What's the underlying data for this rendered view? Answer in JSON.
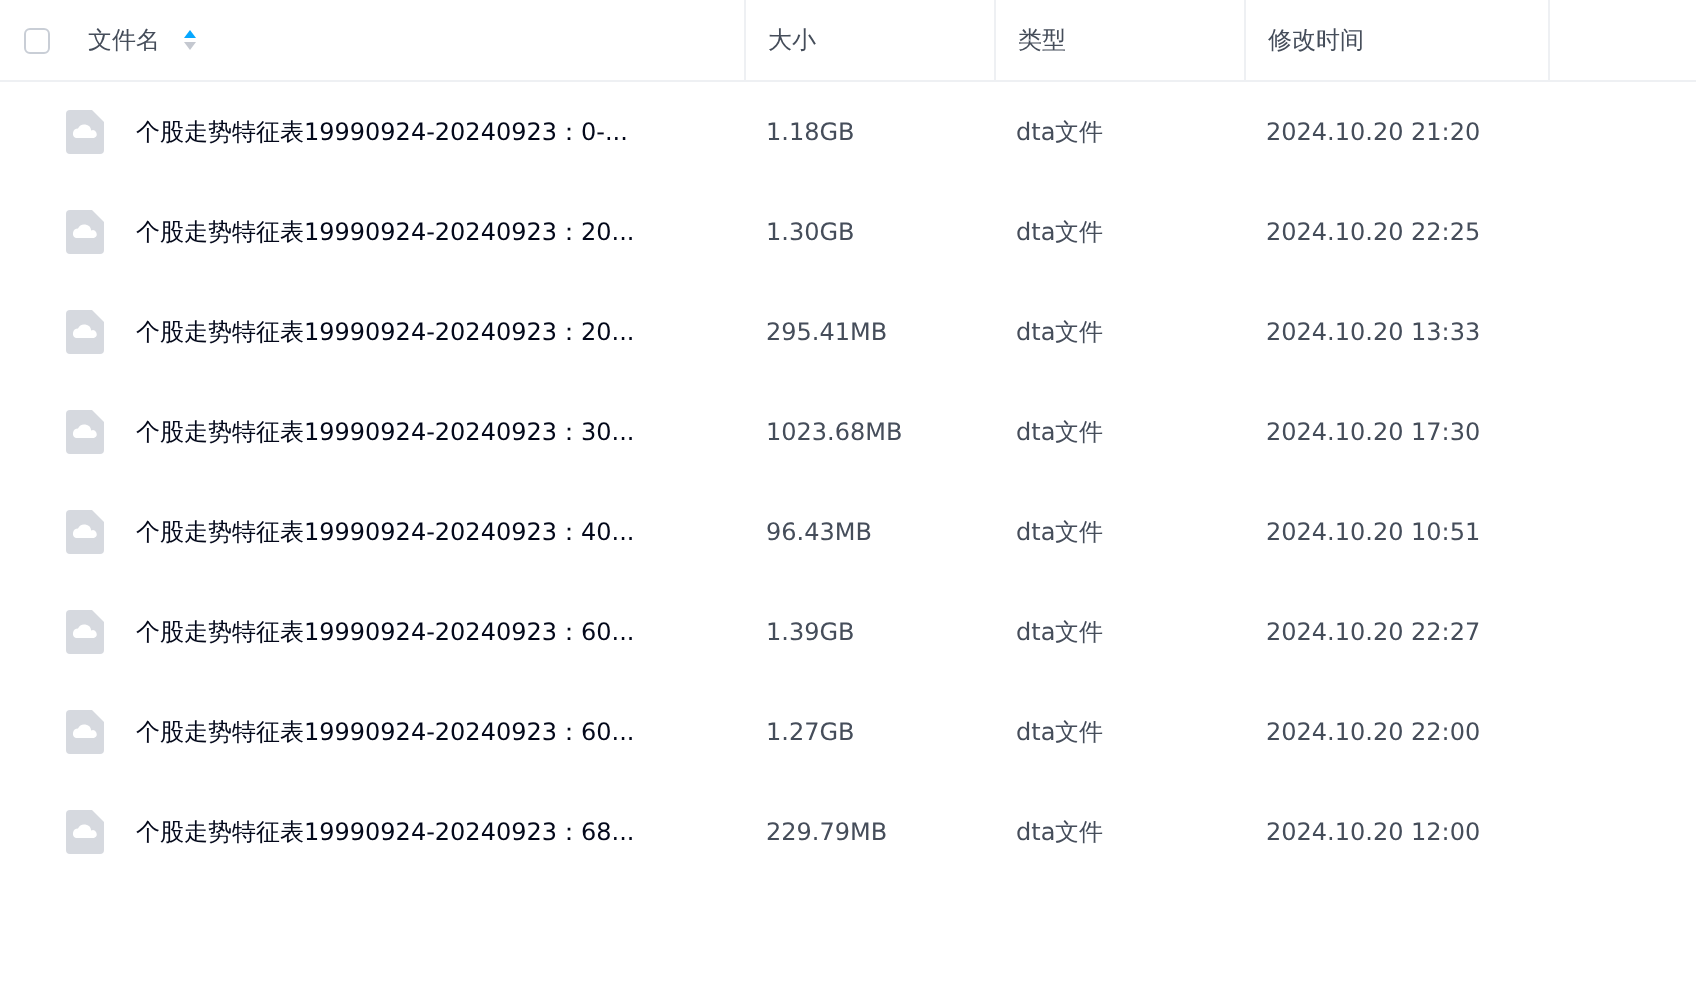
{
  "table": {
    "select_all": {
      "checked": false
    },
    "columns": [
      {
        "label": "文件名",
        "sort_ascending": true
      },
      {
        "label": "大小"
      },
      {
        "label": "类型"
      },
      {
        "label": "修改时间"
      }
    ],
    "rows": [
      {
        "name": "个股走势特征表19990924-20240923：0-...",
        "size": "1.18GB",
        "type": "dta文件",
        "modified": "2024.10.20 21:20"
      },
      {
        "name": "个股走势特征表19990924-20240923：20...",
        "size": "1.30GB",
        "type": "dta文件",
        "modified": "2024.10.20 22:25"
      },
      {
        "name": "个股走势特征表19990924-20240923：20...",
        "size": "295.41MB",
        "type": "dta文件",
        "modified": "2024.10.20 13:33"
      },
      {
        "name": "个股走势特征表19990924-20240923：30...",
        "size": "1023.68MB",
        "type": "dta文件",
        "modified": "2024.10.20 17:30"
      },
      {
        "name": "个股走势特征表19990924-20240923：40...",
        "size": "96.43MB",
        "type": "dta文件",
        "modified": "2024.10.20 10:51"
      },
      {
        "name": "个股走势特征表19990924-20240923：60...",
        "size": "1.39GB",
        "type": "dta文件",
        "modified": "2024.10.20 22:27"
      },
      {
        "name": "个股走势特征表19990924-20240923：60...",
        "size": "1.27GB",
        "type": "dta文件",
        "modified": "2024.10.20 22:00"
      },
      {
        "name": "个股走势特征表19990924-20240923：68...",
        "size": "229.79MB",
        "type": "dta文件",
        "modified": "2024.10.20 12:00"
      }
    ]
  }
}
